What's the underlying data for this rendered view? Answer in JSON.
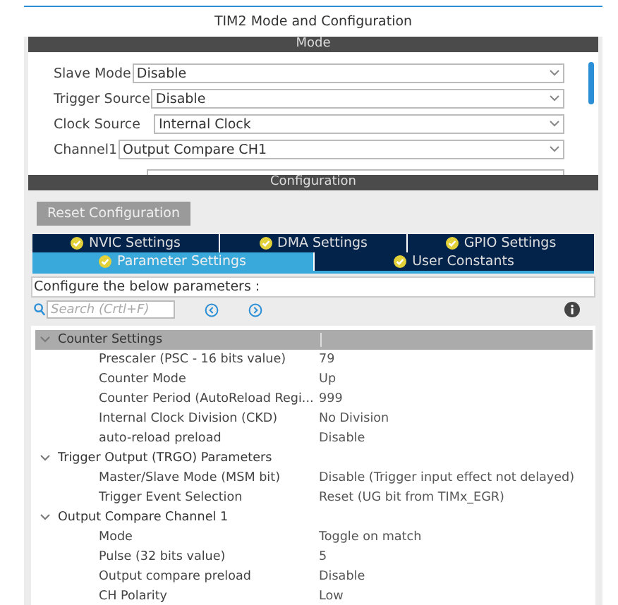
{
  "window": {
    "title": "TIM2 Mode and Configuration"
  },
  "mode": {
    "header": "Mode",
    "fields": [
      {
        "label": "Slave Mode",
        "value": "Disable"
      },
      {
        "label": "Trigger Source",
        "value": "Disable"
      },
      {
        "label": "Clock Source",
        "value": "Internal Clock"
      },
      {
        "label": "Channel1",
        "value": "Output Compare CH1"
      }
    ]
  },
  "configuration": {
    "header": "Configuration",
    "reset_button": "Reset Configuration",
    "tab_rows": [
      [
        {
          "label": "NVIC Settings",
          "selected": false
        },
        {
          "label": "DMA Settings",
          "selected": false
        },
        {
          "label": "GPIO Settings",
          "selected": false
        }
      ],
      [
        {
          "label": "Parameter Settings",
          "selected": true
        },
        {
          "label": "User Constants",
          "selected": false
        }
      ]
    ],
    "hint": "Configure the below parameters :",
    "search": {
      "placeholder": "Search (Crtl+F)"
    },
    "groups": [
      {
        "name": "Counter Settings",
        "expanded": true,
        "selected": true,
        "children": [
          {
            "name": "Prescaler (PSC - 16 bits value)",
            "value": "79"
          },
          {
            "name": "Counter Mode",
            "value": "Up"
          },
          {
            "name": "Counter Period (AutoReload Regi...",
            "value": "999"
          },
          {
            "name": "Internal Clock Division (CKD)",
            "value": "No Division"
          },
          {
            "name": "auto-reload preload",
            "value": "Disable"
          }
        ]
      },
      {
        "name": "Trigger Output (TRGO) Parameters",
        "expanded": true,
        "selected": false,
        "children": [
          {
            "name": "Master/Slave Mode (MSM bit)",
            "value": "Disable (Trigger input effect not delayed)"
          },
          {
            "name": "Trigger Event Selection",
            "value": "Reset (UG bit from TIMx_EGR)"
          }
        ]
      },
      {
        "name": "Output Compare Channel 1",
        "expanded": true,
        "selected": false,
        "children": [
          {
            "name": "Mode",
            "value": "Toggle on match"
          },
          {
            "name": "Pulse (32 bits value)",
            "value": "5"
          },
          {
            "name": "Output compare preload",
            "value": "Disable"
          },
          {
            "name": "CH Polarity",
            "value": "Low"
          }
        ]
      }
    ]
  }
}
